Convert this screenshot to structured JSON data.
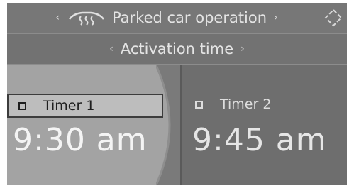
{
  "header": {
    "title": "Parked car operation",
    "left_arrow": "‹",
    "right_arrow": "›",
    "icon": "parked-car-heater-icon",
    "options_icon": "options-icon"
  },
  "subheader": {
    "title": "Activation time",
    "left_arrow": "‹",
    "right_arrow": "›"
  },
  "timers": [
    {
      "label": "Timer 1",
      "time": "9:30 am",
      "selected": true
    },
    {
      "label": "Timer 2",
      "time": "9:45 am",
      "selected": false
    }
  ],
  "colors": {
    "background": "#6f6f6f",
    "selected_panel": "#a3a3a3",
    "text": "#e4e4e4"
  }
}
